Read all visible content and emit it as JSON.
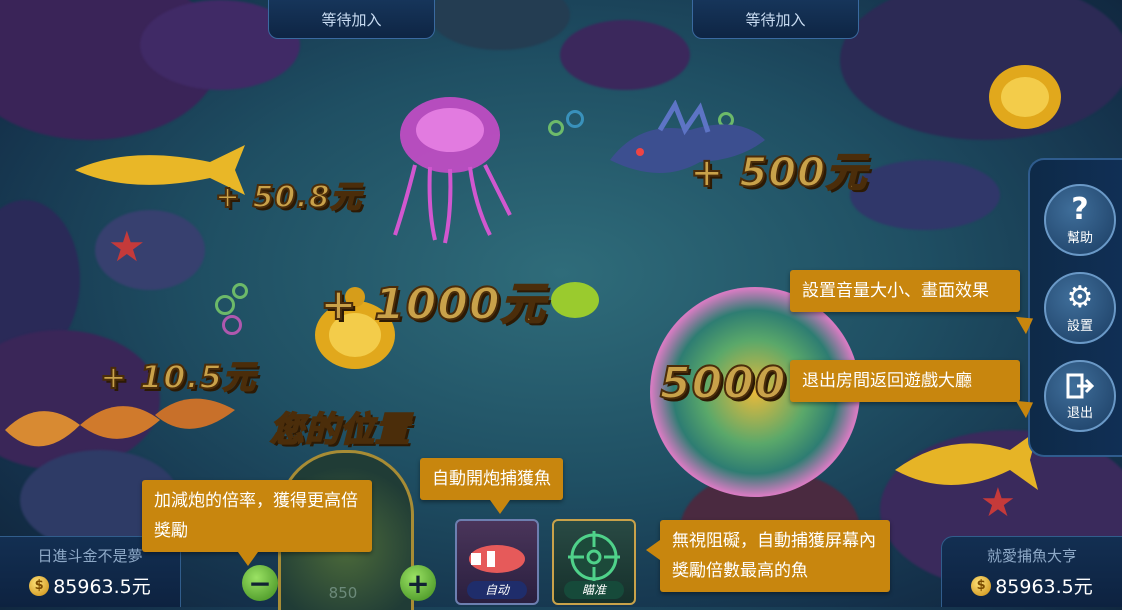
{
  "seats": {
    "left_waiting": "等待加入",
    "right_waiting": "等待加入"
  },
  "rewards": {
    "r1": "+ 50.8元",
    "r2": "+ 500元",
    "r3": "+ 1000元",
    "r4": "+ 10.5元",
    "r5": "5000"
  },
  "your_position": "您的位置",
  "side_menu": {
    "help": "幫助",
    "settings": "設置",
    "exit": "退出"
  },
  "tips": {
    "settings_tip": "設置音量大小、畫面效果",
    "exit_tip": "退出房間返回遊戲大廳",
    "auto_fire_tip": "自動開炮捕獲魚",
    "cannon_rate_tip": "加減炮的倍率，獲得更高倍獎勵",
    "lock_tip": "無視阻礙，自動捕獲屏幕內獎勵倍數最高的魚"
  },
  "players": {
    "left": {
      "name": "日進斗金不是夢",
      "balance": "85963.5元"
    },
    "right": {
      "name": "就愛捕魚大亨",
      "balance": "85963.5元"
    }
  },
  "currency_symbol": "$",
  "skills": {
    "auto": "自动",
    "lock": "瞄准"
  },
  "cannon": {
    "minus": "−",
    "plus": "+",
    "value": "850"
  },
  "colors": {
    "tip_bg": "#c8860e",
    "panel_bg": "#0e2a48",
    "reward_gold": "#c9a24a"
  }
}
